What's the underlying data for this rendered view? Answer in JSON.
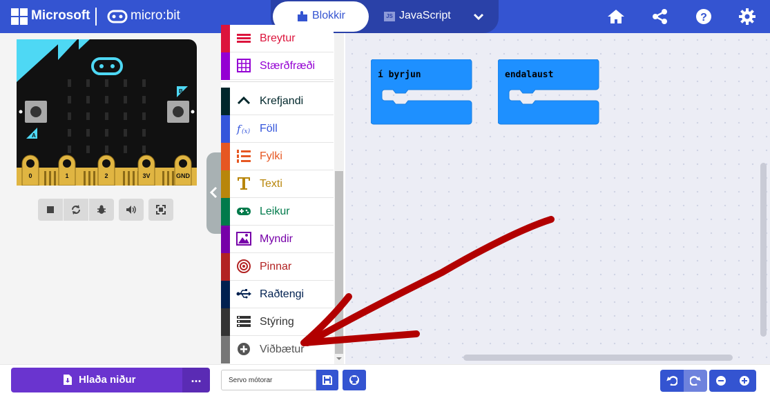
{
  "header": {
    "microsoft_label": "Microsoft",
    "microbit_label": "micro:bit",
    "tabs": [
      {
        "label": "Blokkir",
        "active": true,
        "icon": "puzzle-icon"
      },
      {
        "label": "JavaScript",
        "active": false,
        "icon": "js-icon",
        "icon_text": "JS"
      }
    ],
    "actions": [
      "home-icon",
      "share-icon",
      "help-icon",
      "settings-icon"
    ],
    "accent_color": "#3454d1"
  },
  "simulator": {
    "pin_labels": [
      "0",
      "1",
      "2",
      "3V",
      "GND"
    ],
    "button_labels": [
      "A",
      "B"
    ],
    "controls": [
      "stop-icon",
      "restart-icon",
      "debug-icon",
      "mute-icon",
      "fullscreen-icon"
    ]
  },
  "toolbox": {
    "categories": [
      {
        "label": "Breytur",
        "color": "#dc143c",
        "icon": "variables-icon"
      },
      {
        "label": "Stærðfræði",
        "color": "#9400d3",
        "icon": "math-icon"
      },
      {
        "label": "Krefjandi",
        "color": "#00272b",
        "icon": "advanced-chevron-icon"
      },
      {
        "label": "Föll",
        "color": "#3455db",
        "icon": "functions-icon"
      },
      {
        "label": "Fylki",
        "color": "#e65722",
        "icon": "arrays-icon"
      },
      {
        "label": "Texti",
        "color": "#b8860b",
        "icon": "text-icon"
      },
      {
        "label": "Leikur",
        "color": "#007a4b",
        "icon": "gamepad-icon"
      },
      {
        "label": "Myndir",
        "color": "#7600a8",
        "icon": "images-icon"
      },
      {
        "label": "Pinnar",
        "color": "#b22222",
        "icon": "pins-icon"
      },
      {
        "label": "Raðtengi",
        "color": "#002050",
        "icon": "usb-icon"
      },
      {
        "label": "Stýring",
        "color": "#333333",
        "icon": "control-icon"
      },
      {
        "label": "Viðbætur",
        "color": "#777777",
        "icon": "add-extension-icon"
      }
    ]
  },
  "workspace": {
    "blocks": [
      {
        "label": "í byrjun",
        "color": "#1e90ff"
      },
      {
        "label": "endalaust",
        "color": "#1e90ff"
      }
    ],
    "annotation_color": "#b20000"
  },
  "footer": {
    "download_label": "Hlaða niður",
    "more_label": "...",
    "project_name": "Servo mótorar",
    "buttons": [
      "save-icon",
      "github-icon",
      "undo-icon",
      "redo-icon",
      "zoom-out-icon",
      "zoom-in-icon"
    ],
    "download_color": "#6a34cf"
  }
}
